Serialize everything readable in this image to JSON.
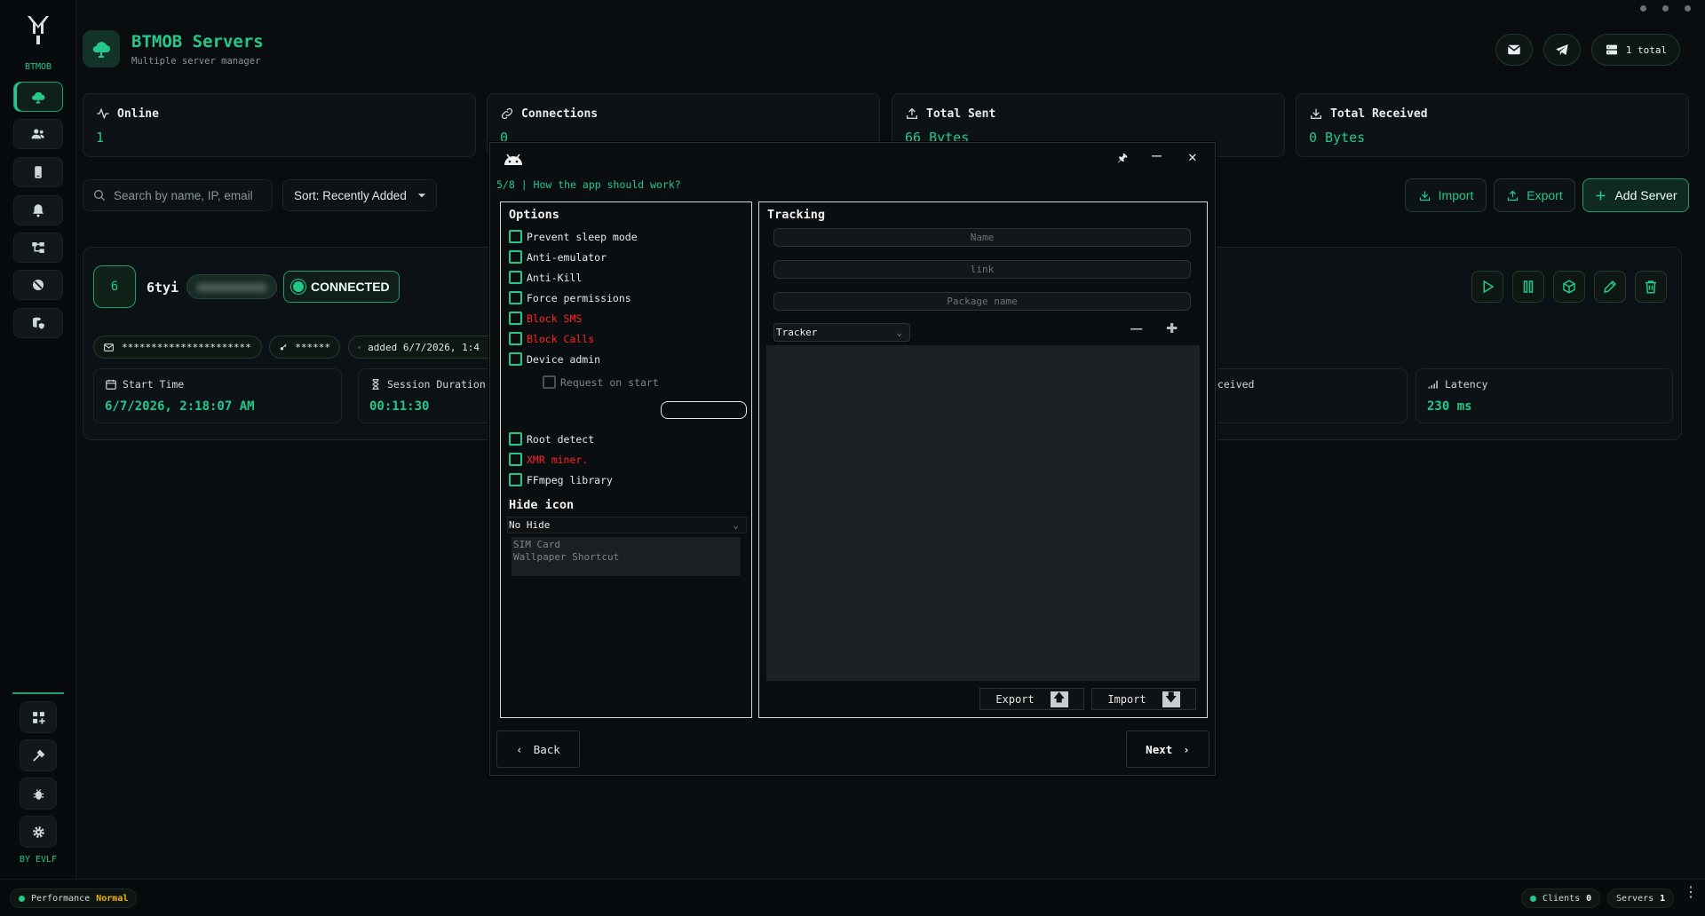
{
  "brand": {
    "name": "BTMOB",
    "credit": "BY EVLF"
  },
  "header": {
    "title": "BTMOB Servers",
    "subtitle": "Multiple server manager",
    "total_label": "1 total"
  },
  "stats": [
    {
      "label": "Online",
      "value": "1",
      "icon": "activity-icon"
    },
    {
      "label": "Connections",
      "value": "0",
      "icon": "link-icon"
    },
    {
      "label": "Total Sent",
      "value": "66 Bytes",
      "icon": "upload-icon"
    },
    {
      "label": "Total Received",
      "value": "0 Bytes",
      "icon": "download-icon"
    }
  ],
  "toolbar": {
    "search_placeholder": "Search by name, IP, email",
    "sort_label": "Sort: Recently Added",
    "import_label": "Import",
    "export_label": "Export",
    "add_server_label": "Add Server"
  },
  "server": {
    "avatar": "6",
    "name": "6tyi",
    "status": "CONNECTED",
    "email_masked": "**********************",
    "password_masked": "******",
    "added": "added 6/7/2026, 1:4",
    "start_time_label": "Start Time",
    "start_time": "6/7/2026, 2:18:07 AM",
    "session_label": "Session Duration",
    "session_value": "00:11:30",
    "received_label": "eceived",
    "latency_label": "Latency",
    "latency_value": "230 ms"
  },
  "dialog": {
    "step": "5/8 | How the app should work?",
    "options_title": "Options",
    "options": [
      {
        "label": "Prevent sleep mode",
        "style": "normal"
      },
      {
        "label": "Anti-emulator",
        "style": "normal"
      },
      {
        "label": "Anti-Kill",
        "style": "normal"
      },
      {
        "label": "Force permissions",
        "style": "normal"
      },
      {
        "label": "Block SMS",
        "style": "red"
      },
      {
        "label": "Block Calls",
        "style": "red"
      },
      {
        "label": "Device admin",
        "style": "normal"
      }
    ],
    "sub_option": "Request on start",
    "options2": [
      {
        "label": "Root detect",
        "style": "normal"
      },
      {
        "label": "XMR miner.",
        "style": "red"
      },
      {
        "label": "FFmpeg library",
        "style": "normal"
      }
    ],
    "hide_title": "Hide icon",
    "hide_selected": "No Hide",
    "hide_list": [
      "SIM Card",
      "Wallpaper Shortcut"
    ],
    "tracking_title": "Tracking",
    "name_placeholder": "Name",
    "link_placeholder": "link",
    "package_placeholder": "Package name",
    "tracker_selected": "Tracker",
    "export_label": "Export",
    "import_label": "Import",
    "back_label": "Back",
    "next_label": "Next"
  },
  "statusbar": {
    "performance_label": "Performance",
    "performance_value": "Normal",
    "clients_label": "Clients",
    "clients_value": "0",
    "servers_label": "Servers",
    "servers_value": "1"
  },
  "colors": {
    "accent": "#22c98a",
    "danger": "#ff2424",
    "background": "#0a0d10"
  }
}
